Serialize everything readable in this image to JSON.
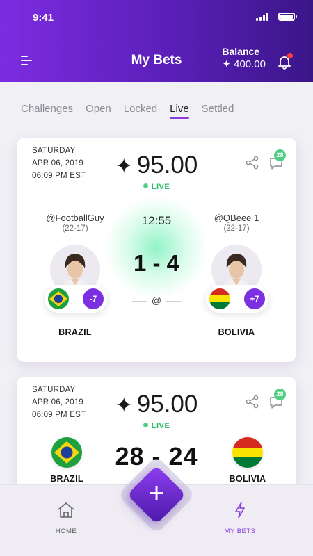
{
  "status_bar": {
    "time": "9:41"
  },
  "header": {
    "title": "My Bets",
    "balance_label": "Balance",
    "balance_value": "✦ 400.00",
    "brand_colors": {
      "primary": "#7d2ce0",
      "dark": "#3a1588",
      "accent_green": "#4fcf83"
    }
  },
  "tabs": [
    {
      "label": "Challenges",
      "active": false
    },
    {
      "label": "Open",
      "active": false
    },
    {
      "label": "Locked",
      "active": false
    },
    {
      "label": "Live",
      "active": true
    },
    {
      "label": "Settled",
      "active": false
    }
  ],
  "cards": [
    {
      "day": "SATURDAY",
      "date": "APR 06, 2019",
      "time": "06:09 PM EST",
      "amount": "95.00",
      "amount_icon": "✦",
      "status": "LIVE",
      "chat_count": "28",
      "clock": "12:55",
      "score": "1 - 4",
      "at_symbol": "@",
      "home": {
        "user": "@FootballGuy",
        "record": "(22-17)",
        "spread": "-7",
        "team": "BRAZIL"
      },
      "away": {
        "user": "@QBeee 1",
        "record": "(22-17)",
        "spread": "+7",
        "team": "BOLIVIA"
      }
    },
    {
      "day": "SATURDAY",
      "date": "APR 06, 2019",
      "time": "06:09 PM EST",
      "amount": "95.00",
      "amount_icon": "✦",
      "status": "LIVE",
      "chat_count": "28",
      "score": "28  - 24",
      "home": {
        "team": "BRAZIL"
      },
      "away": {
        "team": "BOLIVIA"
      }
    }
  ],
  "bottom_nav": {
    "home_label": "HOME",
    "mybets_label": "MY BETS",
    "add_label": "+"
  }
}
